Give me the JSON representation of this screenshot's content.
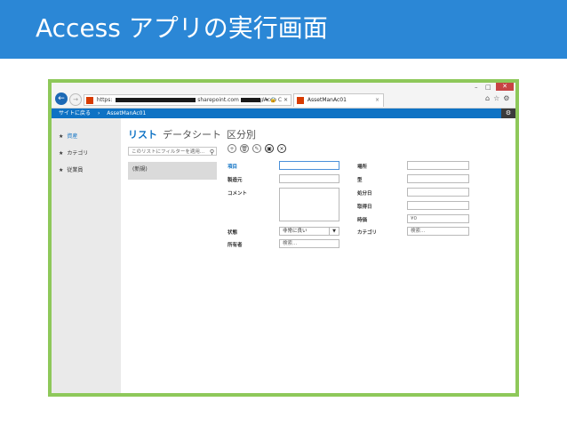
{
  "slide": {
    "title": "Access アプリの実行画面"
  },
  "window": {
    "minimize": "–",
    "restore": "□",
    "close": "✕"
  },
  "browser": {
    "url_prefix": "https:",
    "url_domain": "sharepoint.com",
    "url_tail": "/Acce",
    "addr_icons": "ρ ▾ 🔒 C ✕",
    "tab_title": "AssetManAc01",
    "tab_close": "×",
    "toolbar_icons": [
      "home-icon",
      "star-icon",
      "gear-icon"
    ]
  },
  "navbar": {
    "back_to_site": "サイトに戻る",
    "separator": "›",
    "app_name": "AssetManAc01"
  },
  "sidebar": {
    "items": [
      {
        "label": "資産",
        "active": true
      },
      {
        "label": "カテゴリ",
        "active": false
      },
      {
        "label": "従業員",
        "active": false
      }
    ]
  },
  "view_tabs": {
    "list": "リスト",
    "datasheet": "データシート",
    "grouped": "区分別"
  },
  "filter": {
    "placeholder": "このリストにフィルターを適用...",
    "icon": "search-icon"
  },
  "list": {
    "new_item": "(新規)"
  },
  "actions": [
    {
      "name": "add",
      "glyph": "+"
    },
    {
      "name": "delete",
      "glyph": "🗑"
    },
    {
      "name": "edit",
      "glyph": "✎"
    },
    {
      "name": "save",
      "glyph": "▣"
    },
    {
      "name": "cancel",
      "glyph": "×"
    }
  ],
  "form": {
    "item": "項目",
    "manufacturer": "製造元",
    "comment": "コメント",
    "condition": "状態",
    "condition_value": "非常に良い",
    "owner": "所有者",
    "owner_placeholder": "検索...",
    "location": "場所",
    "model": "型",
    "acquired_date": "処分日",
    "retired_date": "取得日",
    "current_value": "時価",
    "current_value_value": "¥0",
    "category": "カテゴリ",
    "category_placeholder": "検索..."
  }
}
